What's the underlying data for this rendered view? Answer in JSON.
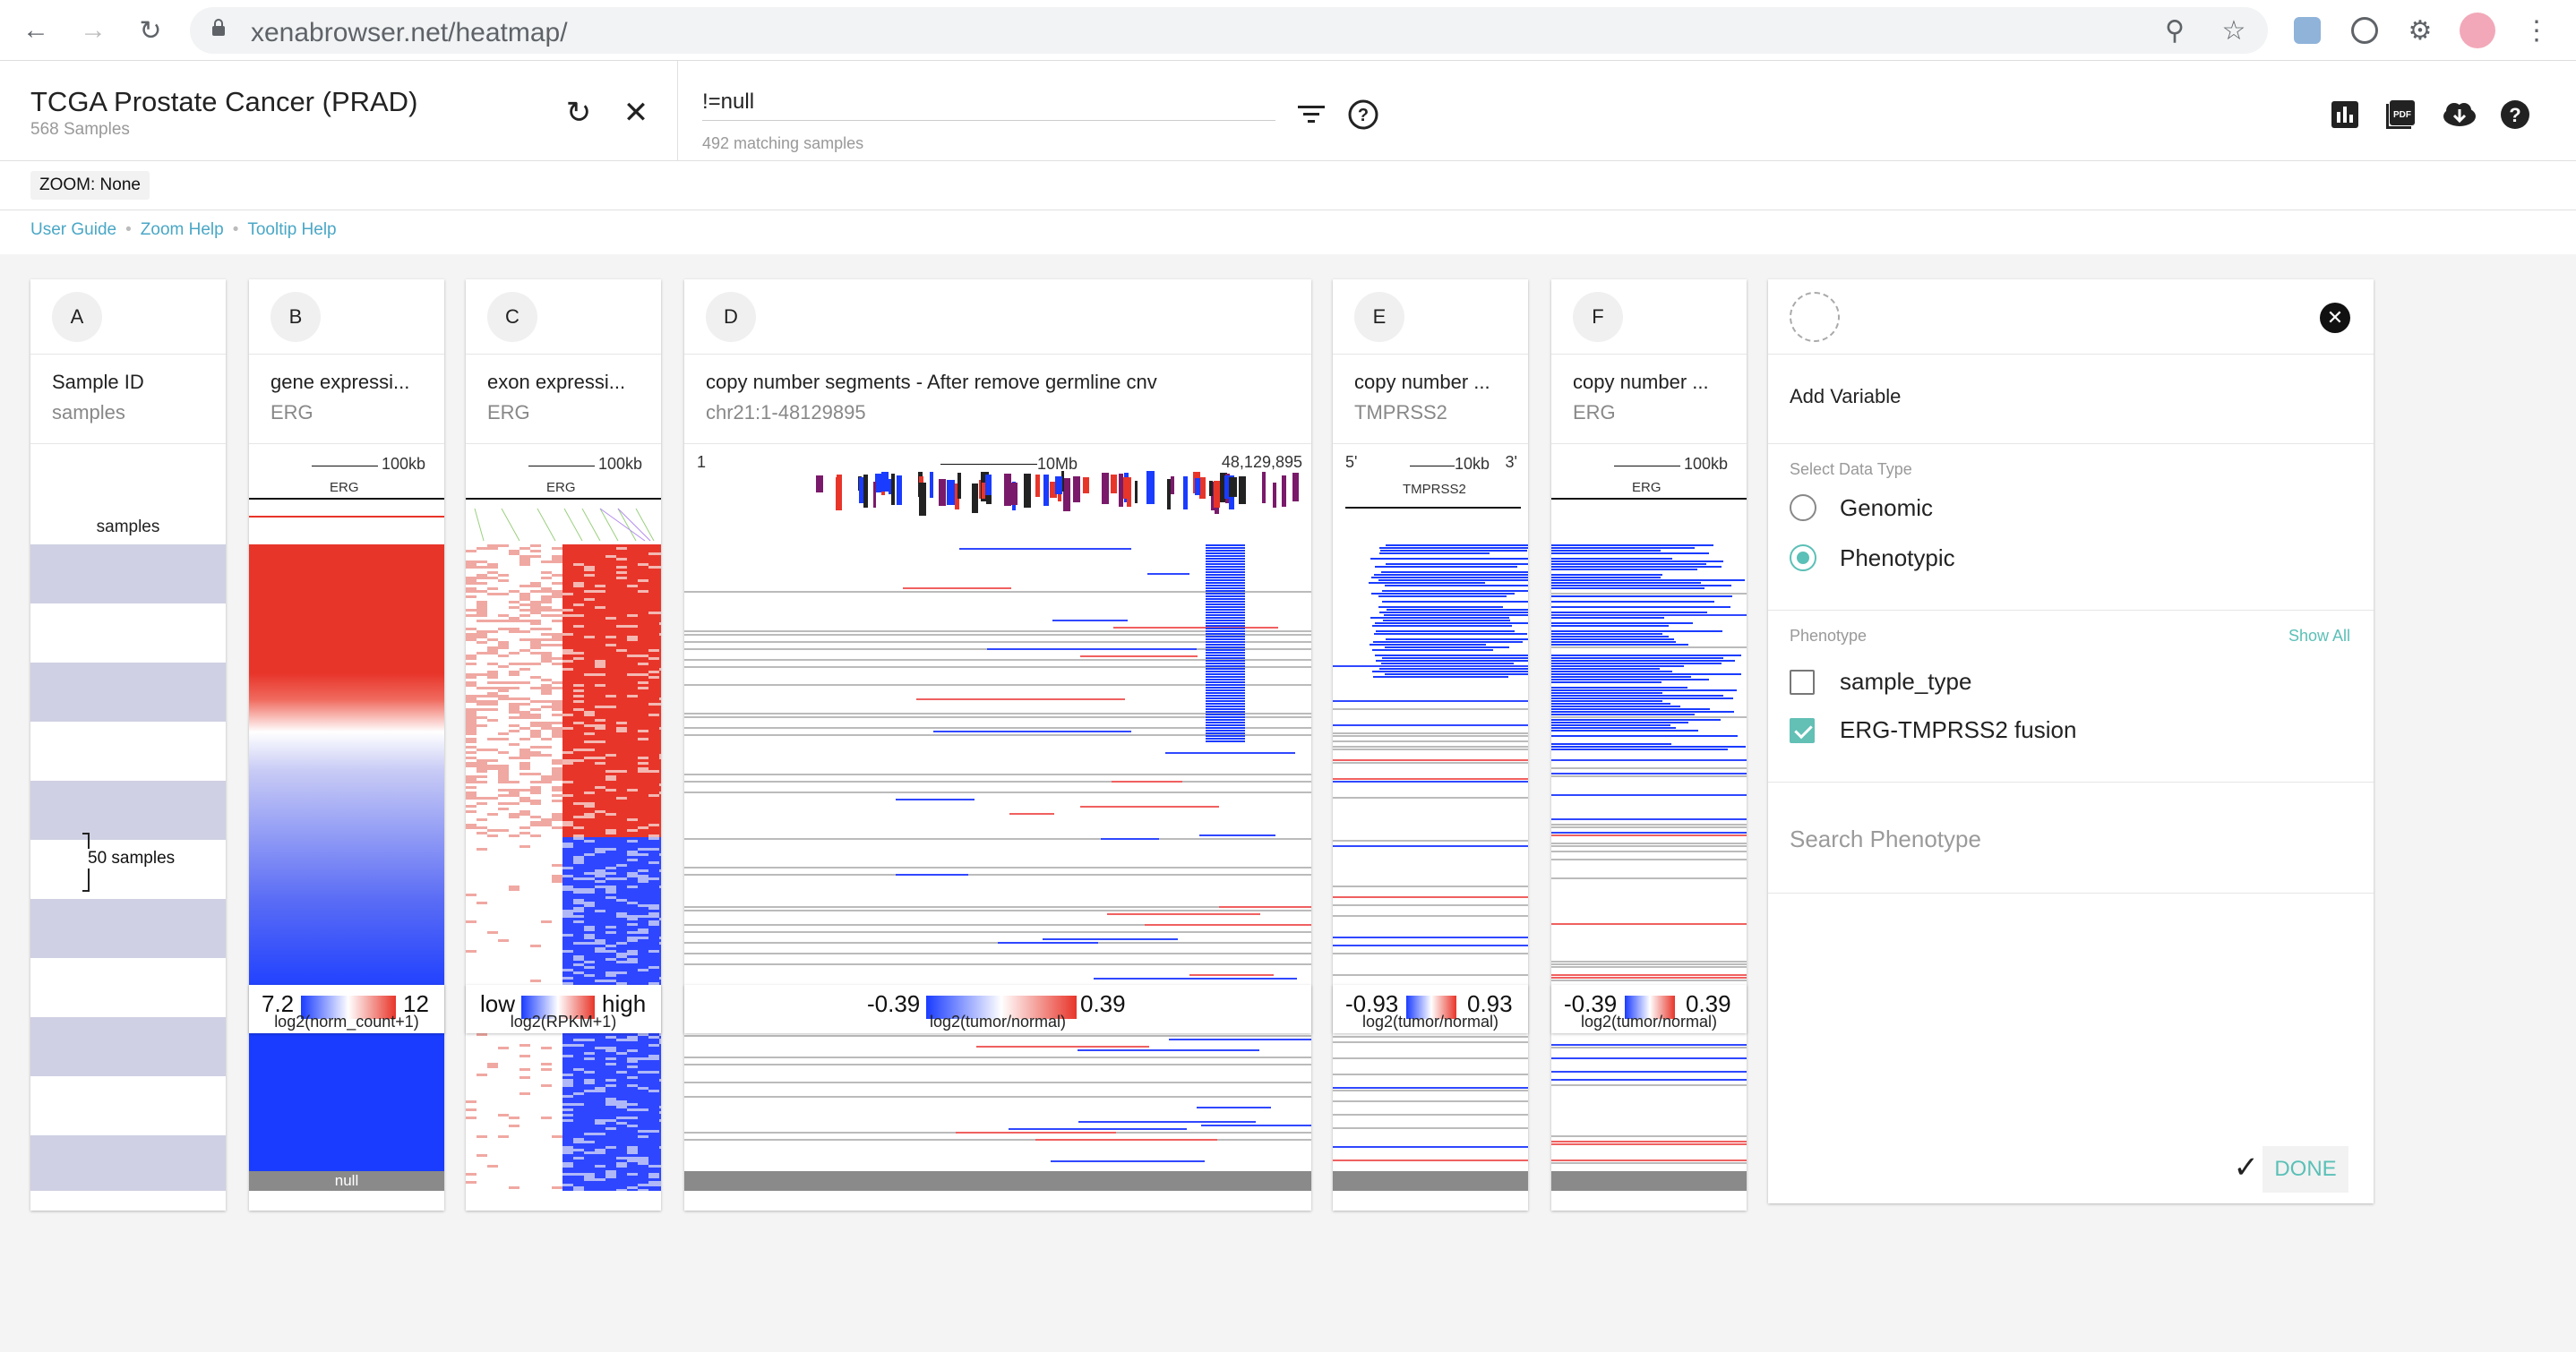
{
  "browser": {
    "url_host": "xenabrowser.net",
    "url_path": "/heatmap/",
    "icons": [
      "back-icon",
      "forward-icon",
      "reload-icon",
      "lock-icon",
      "zoom-icon",
      "star-icon",
      "extension-icon",
      "puzzle-icon",
      "avatar",
      "menu-icon"
    ]
  },
  "header": {
    "title": "TCGA Prostate Cancer (PRAD)",
    "samples": "568 Samples",
    "filter_value": "!=null",
    "matching": "492 matching samples"
  },
  "zoom_label": "ZOOM: None",
  "links": [
    "User Guide",
    "Zoom Help",
    "Tooltip Help"
  ],
  "columns": [
    {
      "letter": "A",
      "field": "Sample ID",
      "sub": "samples",
      "body_label": "samples",
      "bracket_label": "50 samples"
    },
    {
      "letter": "B",
      "field": "gene expressi...",
      "sub": "ERG",
      "scale": "100kb",
      "gene": "ERG",
      "null_label": "null"
    },
    {
      "letter": "C",
      "field": "exon expressi...",
      "sub": "ERG",
      "scale": "100kb",
      "gene": "ERG"
    },
    {
      "letter": "D",
      "field": "copy number segments - After remove germline cnv",
      "sub": "chr21:1-48129895",
      "start": "1",
      "scale": "10Mb",
      "end": "48,129,895"
    },
    {
      "letter": "E",
      "field": "copy number ...",
      "sub": "TMPRSS2",
      "left": "5'",
      "scale": "10kb",
      "right": "3'",
      "gene": "TMPRSS2"
    },
    {
      "letter": "F",
      "field": "copy number ...",
      "sub": "ERG",
      "scale": "100kb",
      "gene": "ERG"
    }
  ],
  "legends": [
    {
      "low": "7.2",
      "high": "12",
      "label": "log2(norm_count+1)"
    },
    {
      "low": "low",
      "high": "high",
      "label": "log2(RPKM+1)"
    },
    {
      "low": "-0.39",
      "high": "0.39",
      "label": "log2(tumor/normal)"
    },
    {
      "low": "-0.93",
      "high": "0.93",
      "label": "log2(tumor/normal)"
    },
    {
      "low": "-0.39",
      "high": "0.39",
      "label": "log2(tumor/normal)"
    }
  ],
  "panel": {
    "add_variable": "Add Variable",
    "select_type": "Select Data Type",
    "genomic": "Genomic",
    "phenotypic": "Phenotypic",
    "phenotype": "Phenotype",
    "show_all": "Show All",
    "pheno_items": [
      "sample_type",
      "ERG-TMPRSS2 fusion"
    ],
    "search_placeholder": "Search Phenotype",
    "done": "DONE"
  },
  "colors": {
    "accent": "#5bc0b7",
    "link": "#4aa7c6",
    "red": "#e8352a",
    "blue": "#1a3cff"
  }
}
